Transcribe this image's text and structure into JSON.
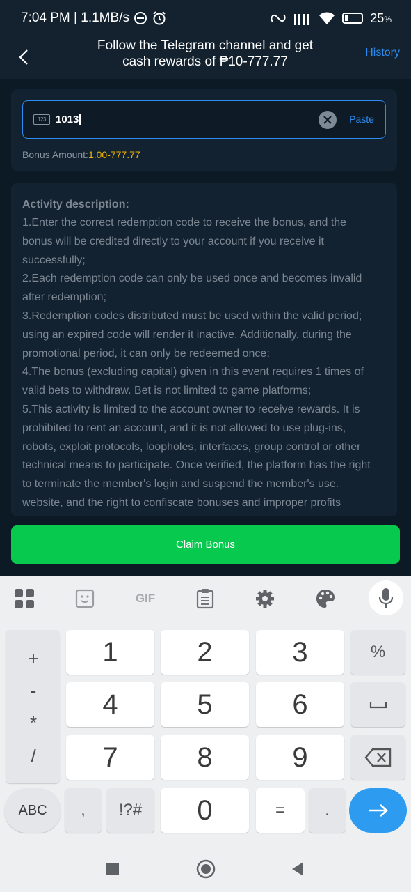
{
  "status_bar": {
    "time_speed": "7:04 PM | 1.1MB/s",
    "battery_pct": "25",
    "battery_unit": "%"
  },
  "header": {
    "title_line1": "Follow the Telegram channel and get",
    "title_line2": "cash rewards of ₱10-777.77",
    "history_label": "History"
  },
  "code_form": {
    "input_value": "1013",
    "paste_label": "Paste",
    "icon_text": "123",
    "bonus_label": "Bonus Amount:",
    "bonus_value": "1.00-777.77"
  },
  "description": {
    "title": "Activity description:",
    "lines": [
      "1.Enter the correct redemption code to receive the bonus, and the",
      "bonus will be credited directly to your account if you receive it",
      "successfully;",
      "2.Each redemption code can only be used once and becomes invalid",
      "after redemption;",
      "3.Redemption codes distributed must be used within the valid period;",
      "using an expired code will render it inactive. Additionally, during the",
      "promotional period, it can only be redeemed once;",
      "4.The bonus (excluding capital) given in this event requires 1 times of",
      "valid bets to withdraw. Bet is not limited to game platforms;",
      "5.This activity is limited to the account owner to receive rewards. It is",
      "prohibited to rent an account, and it is not allowed to use plug-ins,",
      "robots, exploit protocols, loopholes, interfaces, group control or other",
      "technical means to participate. Once verified, the platform has the right",
      "to terminate the member's login and suspend the member's use.",
      "website, and the right to confiscate bonuses and improper profits"
    ]
  },
  "claim": {
    "label": "Claim Bonus"
  },
  "keyboard": {
    "toolbar": {
      "gif_label": "GIF"
    },
    "side_symbols": [
      "+",
      "-",
      "*",
      "/"
    ],
    "digits": [
      "1",
      "2",
      "3",
      "4",
      "5",
      "6",
      "7",
      "8",
      "9",
      "0"
    ],
    "percent": "%",
    "comma": ",",
    "symbols": "!?#",
    "equals": "=",
    "period": ".",
    "abc": "ABC"
  },
  "colors": {
    "accent_blue": "#2d8cf0",
    "bonus_gold": "#f0b400",
    "claim_green": "#06c94d",
    "enter_blue": "#2d9cf0"
  }
}
